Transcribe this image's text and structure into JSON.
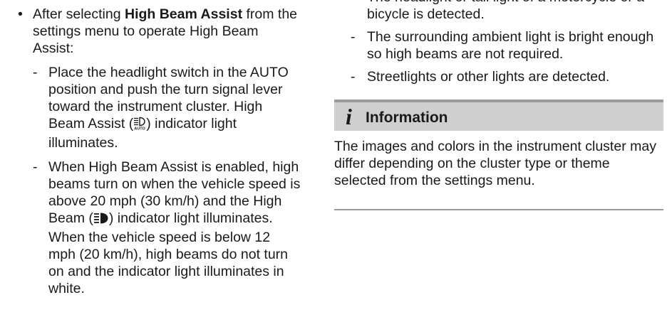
{
  "left": {
    "bullet_mark": "•",
    "bullet": {
      "prefix": "After selecting ",
      "bold": "High Beam Assist",
      "suffix": " from the settings menu to operate High Beam Assist:"
    },
    "sub1": {
      "dash": "-",
      "text_before_icon": "Place the headlight switch in the AUTO position and push the turn signal lever toward the instrument cluster. High Beam Assist (",
      "icon": "high-beam-assist-auto-icon",
      "text_after_icon": ") indicator light illuminates."
    },
    "sub2": {
      "dash": "-",
      "text_before_icon": "When High Beam Assist is enabled, high beams turn on when the vehicle speed is above 20 mph (30 km/h) and the High Beam (",
      "icon": "high-beam-icon",
      "text_after_icon": ") indicator light illuminates. When the vehicle speed is below 12 mph (20 km/h), high beams do not turn on and the indicator light illuminates in white."
    }
  },
  "right": {
    "items": [
      {
        "dash": "-",
        "text": "The headlight or tail light of a motorcycle or a bicycle is detected."
      },
      {
        "dash": "-",
        "text": "The surrounding ambient light is bright enough so high beams are not required."
      },
      {
        "dash": "-",
        "text": "Streetlights or other lights are detected."
      }
    ],
    "info": {
      "icon_glyph": "i",
      "icon": "information-icon",
      "title": "Information",
      "body": "The images and colors in the instrument cluster may differ depending on the cluster type or theme selected from the settings menu."
    }
  },
  "colors": {
    "text": "#1a1a1a",
    "info_header_bg": "#cfcfcf",
    "info_border": "#9a9a9a"
  }
}
